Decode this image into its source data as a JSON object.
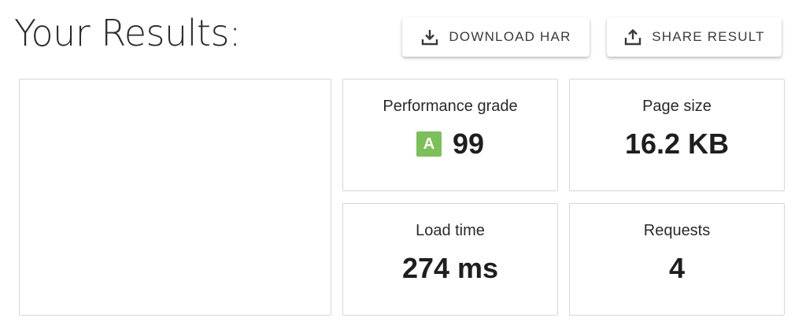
{
  "header": {
    "title": "Your Results:"
  },
  "actions": {
    "download_label": "DOWNLOAD HAR",
    "download_icon": "download-icon",
    "share_label": "SHARE RESULT",
    "share_icon": "share-upload-icon"
  },
  "metrics": {
    "performance": {
      "label": "Performance grade",
      "grade": "A",
      "grade_color": "#7cc05a",
      "value": "99"
    },
    "page_size": {
      "label": "Page size",
      "value": "16.2 KB"
    },
    "load_time": {
      "label": "Load time",
      "value": "274 ms"
    },
    "requests": {
      "label": "Requests",
      "value": "4"
    }
  }
}
